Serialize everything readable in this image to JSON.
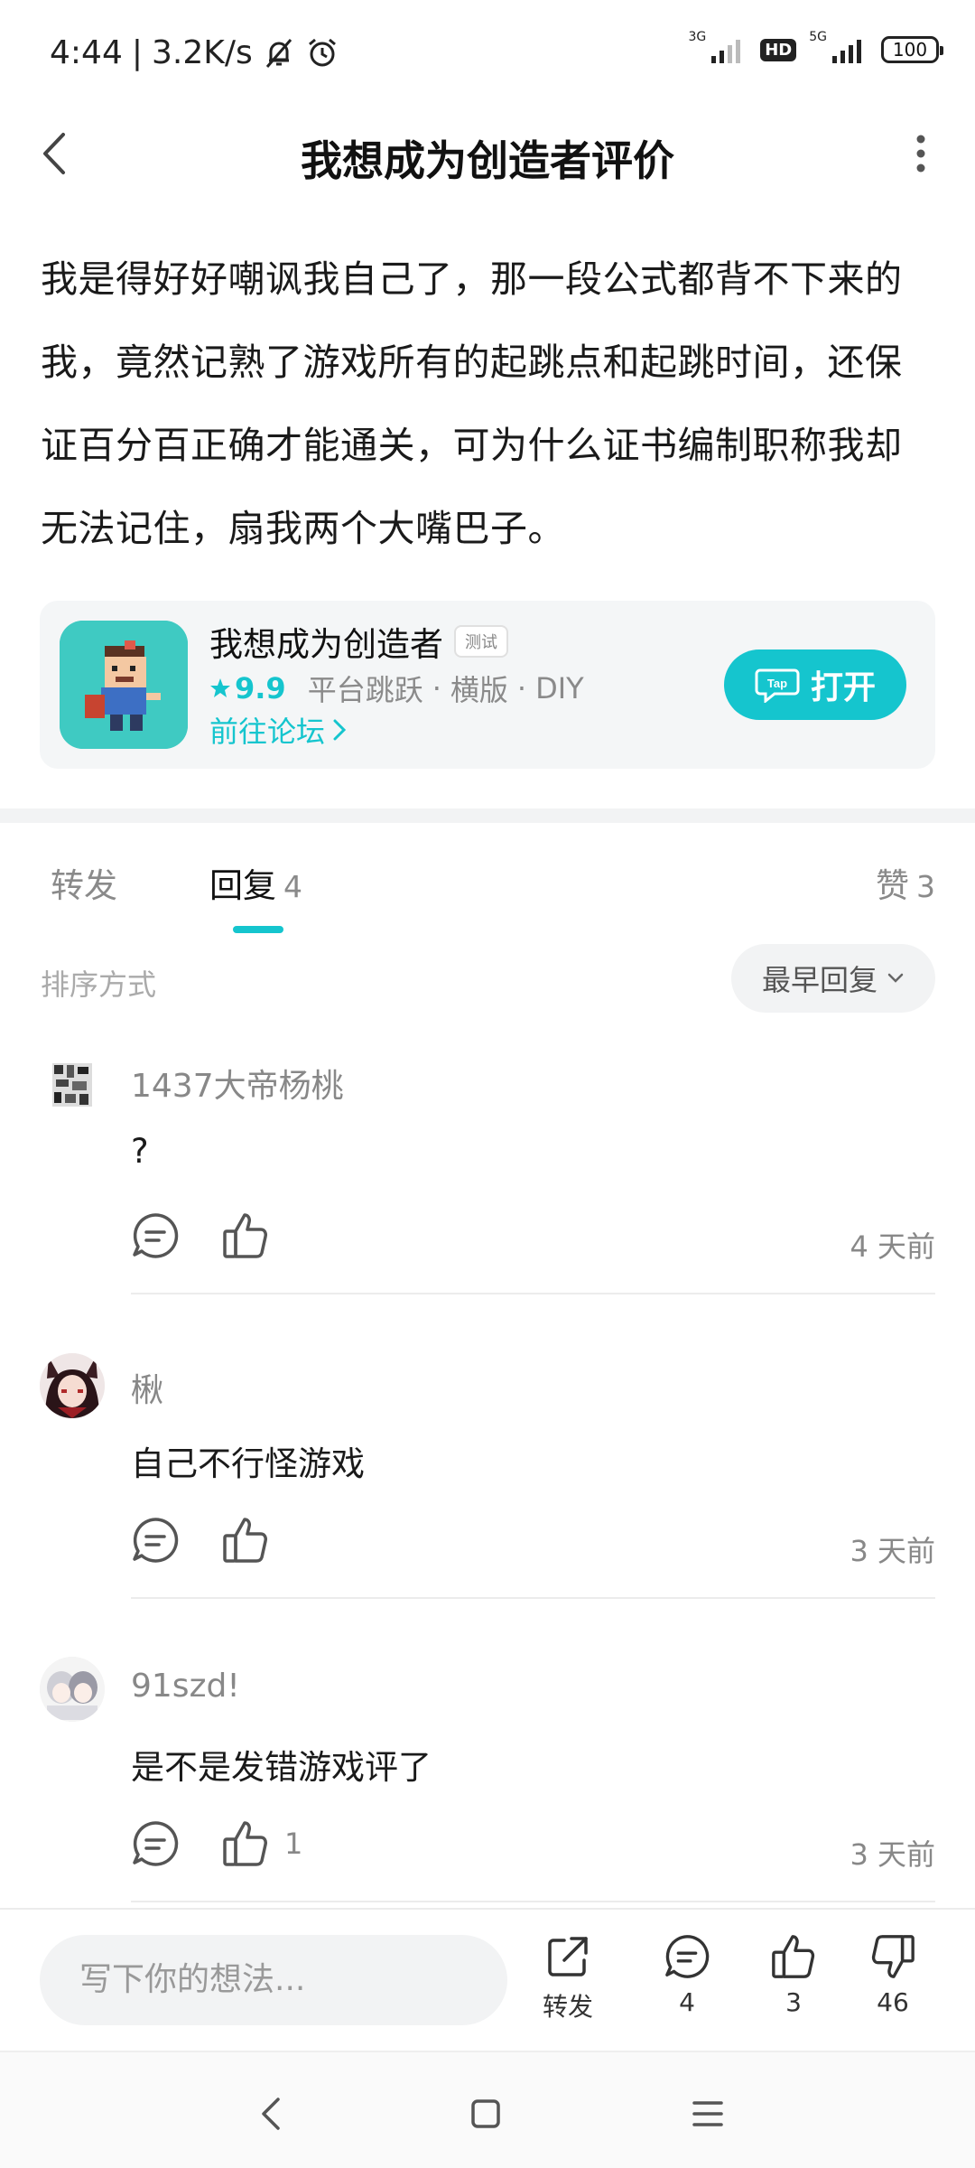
{
  "status_bar": {
    "time": "4:44",
    "separator": "|",
    "speed": "3.2K/s",
    "net1": "3G",
    "hd": "HD",
    "net2": "5G",
    "battery": "100"
  },
  "header": {
    "title": "我想成为创造者评价"
  },
  "review": {
    "text": "我是得好好嘲讽我自己了，那一段公式都背不下来的我，竟然记熟了游戏所有的起跳点和起跳时间，还保证百分百正确才能通关，可为什么证书编制职称我却无法记住，扇我两个大嘴巴子。"
  },
  "game_card": {
    "name": "我想成为创造者",
    "badge": "测试",
    "rating": "9.9",
    "tags": [
      "平台跳跃",
      "横版",
      "DIY"
    ],
    "tag_sep": "·",
    "forum_link": "前往论坛",
    "open_button": "打开",
    "accent_color": "#15c5ce"
  },
  "tabs": {
    "repost": "转发",
    "reply": "回复",
    "reply_count": "4",
    "likes": "赞",
    "likes_count": "3"
  },
  "sort": {
    "label": "排序方式",
    "value": "最早回复"
  },
  "comments": [
    {
      "name": "1437大帝杨桃",
      "body": "?",
      "likes": "",
      "time": "4 天前"
    },
    {
      "name": "楸",
      "body": "自己不行怪游戏",
      "likes": "",
      "time": "3 天前"
    },
    {
      "name": "91szd!",
      "body": "是不是发错游戏评了",
      "likes": "1",
      "time": "3 天前"
    }
  ],
  "bottom_bar": {
    "input_placeholder": "写下你的想法...",
    "repost_label": "转发",
    "comment_count": "4",
    "like_count": "3",
    "dislike_count": "46"
  }
}
